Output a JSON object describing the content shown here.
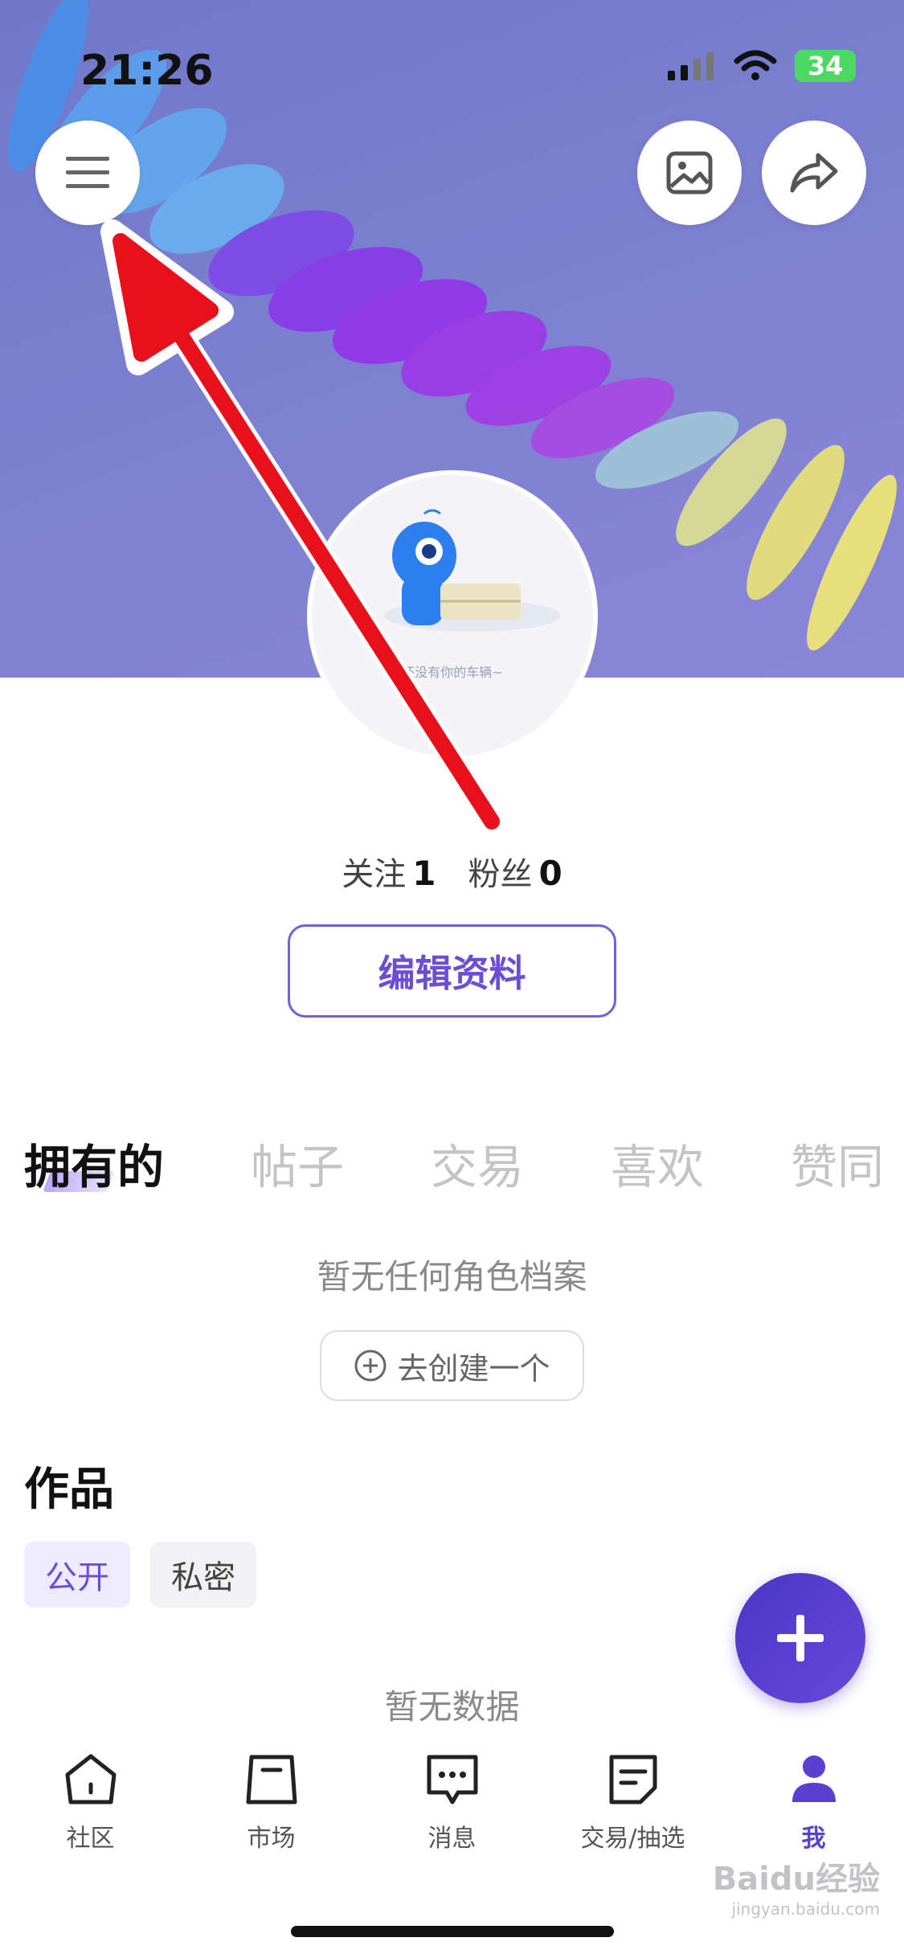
{
  "status_bar": {
    "time": "21:26",
    "battery": "34"
  },
  "avatar": {
    "caption": "还没有你的车辆~"
  },
  "stats": {
    "following_label": "关注",
    "following_count": "1",
    "followers_label": "粉丝",
    "followers_count": "0"
  },
  "edit_profile_label": "编辑资料",
  "tabs": [
    "拥有的",
    "帖子",
    "交易",
    "喜欢",
    "赞同"
  ],
  "roles_empty_text": "暂无任何角色档案",
  "create_label": "去创建一个",
  "works": {
    "title": "作品",
    "chips": [
      "公开",
      "私密"
    ],
    "empty_text": "暂无数据"
  },
  "tabbar": [
    {
      "label": "社区",
      "icon": "home-icon"
    },
    {
      "label": "市场",
      "icon": "market-icon"
    },
    {
      "label": "消息",
      "icon": "message-icon"
    },
    {
      "label": "交易/抽选",
      "icon": "trade-icon"
    },
    {
      "label": "我",
      "icon": "profile-icon"
    }
  ],
  "watermark": {
    "brand": "Baidu经验",
    "url": "jingyan.baidu.com"
  },
  "colors": {
    "accent": "#6a4fd6",
    "arrow": "#e8101a",
    "banner": "#7c7fd0"
  }
}
